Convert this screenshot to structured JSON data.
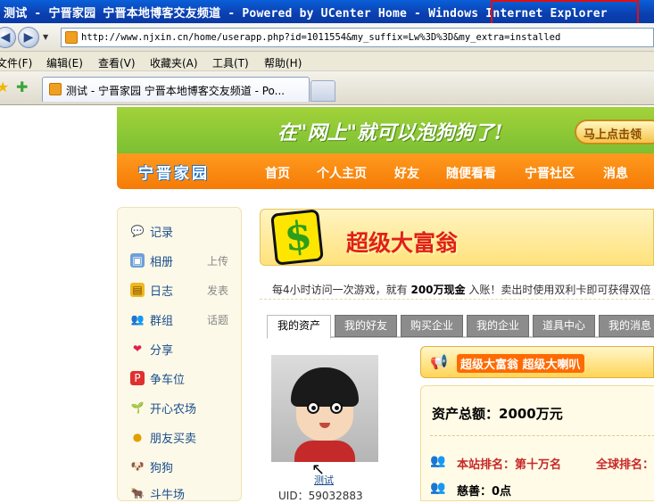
{
  "window": {
    "title": "测试 - 宁晋家园 宁晋本地博客交友频道 - Powered by UCenter Home - Windows Internet Explorer"
  },
  "addressbar": {
    "url": "http://www.njxin.cn/home/userapp.php?id=1011554&my_suffix=Lw%3D%3D&my_extra=installed"
  },
  "menu": {
    "items": [
      "文件(F)",
      "编辑(E)",
      "查看(V)",
      "收藏夹(A)",
      "工具(T)",
      "帮助(H)"
    ]
  },
  "tab": {
    "active_label": "测试 - 宁晋家园 宁晋本地博客交友频道 - Po..."
  },
  "banner": {
    "slogan": "在\"网上\"就可以泡狗狗了!",
    "signup": "马上点击领"
  },
  "site": {
    "logo": "宁晋家园",
    "nav": [
      "首页",
      "个人主页",
      "好友",
      "随便看看",
      "宁晋社区",
      "消息"
    ]
  },
  "sidebar": {
    "items": [
      {
        "label": "记录",
        "extra": ""
      },
      {
        "label": "相册",
        "extra": "上传"
      },
      {
        "label": "日志",
        "extra": "发表"
      },
      {
        "label": "群组",
        "extra": "话题"
      },
      {
        "label": "分享",
        "extra": ""
      },
      {
        "label": "争车位",
        "extra": ""
      },
      {
        "label": "开心农场",
        "extra": ""
      },
      {
        "label": "朋友买卖",
        "extra": ""
      },
      {
        "label": "狗狗",
        "extra": ""
      },
      {
        "label": "斗牛场",
        "extra": ""
      }
    ]
  },
  "app": {
    "title": "超级大富翁",
    "notice_pre": "每4小时访问一次游戏，就有",
    "notice_bold": "200万现金",
    "notice_post": "入账！卖出时使用双利卡即可获得双倍",
    "tabs": [
      "我的资产",
      "我的好友",
      "购买企业",
      "我的企业",
      "道具中心",
      "我的消息"
    ],
    "horn_label": "超级大富翁 超级大喇叭",
    "total_label": "资产总额：2000万元",
    "rank_site": "本站排名：第十万名",
    "rank_global": "全球排名：",
    "charity": "慈善：0点"
  },
  "user": {
    "name": "测试",
    "uid": "UID：59032883"
  }
}
